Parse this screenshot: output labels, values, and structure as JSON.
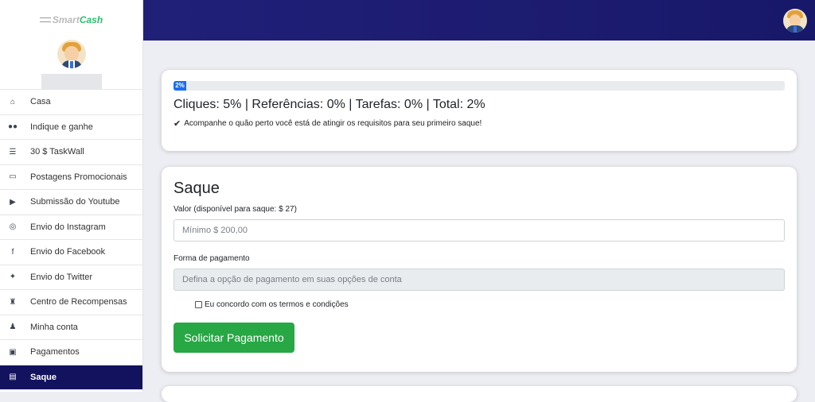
{
  "brand": {
    "prefix": "Smart",
    "suffix": "Cash"
  },
  "sidebar": {
    "items": [
      {
        "label": "Casa",
        "icon": "home-icon",
        "glyph": "⌂"
      },
      {
        "label": "Indique e ganhe",
        "icon": "users-icon",
        "glyph": "👥"
      },
      {
        "label": "30 $ TaskWall",
        "icon": "list-icon",
        "glyph": "☰"
      },
      {
        "label": "Postagens Promocionais",
        "icon": "id-card-icon",
        "glyph": "▭"
      },
      {
        "label": "Submissão do Youtube",
        "icon": "youtube-icon",
        "glyph": "▶"
      },
      {
        "label": "Envio do Instagram",
        "icon": "instagram-icon",
        "glyph": "◎"
      },
      {
        "label": "Envio do Facebook",
        "icon": "facebook-icon",
        "glyph": "f"
      },
      {
        "label": "Envio do Twitter",
        "icon": "twitter-icon",
        "glyph": "✦"
      },
      {
        "label": "Centro de Recompensas",
        "icon": "trophy-icon",
        "glyph": "🏆"
      },
      {
        "label": "Minha conta",
        "icon": "user-icon",
        "glyph": "👤"
      },
      {
        "label": "Pagamentos",
        "icon": "money-icon",
        "glyph": "▣"
      },
      {
        "label": "Saque",
        "icon": "document-icon",
        "glyph": "▤"
      }
    ]
  },
  "progress": {
    "label": "2%",
    "value": 2
  },
  "stats_text": "Cliques: 5% | Referências: 0% | Tarefas: 0% | Total: 2%",
  "note_text": "Acompanhe o quão perto você está de atingir os requisitos para seu primeiro saque!",
  "withdraw": {
    "title": "Saque",
    "amount_label": "Valor (disponível para saque: $ 27)",
    "amount_placeholder": "Mínimo $ 200,00",
    "method_label": "Forma de pagamento",
    "method_placeholder": "Defina a opção de pagamento em suas opções de conta",
    "agree_label": "Eu concordo com os termos e condições",
    "submit_label": "Solicitar Pagamento"
  },
  "colors": {
    "topbar": "#212079",
    "active": "#12125e",
    "button": "#28a745",
    "progress": "#1b6cf2"
  }
}
